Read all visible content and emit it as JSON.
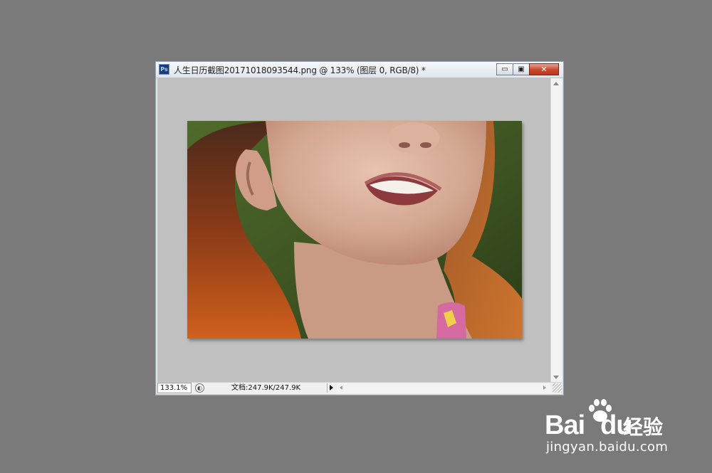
{
  "document_window": {
    "app_icon_text": "Ps",
    "title": "人生日历截图20171018093544.png @ 133% (图层 0, RGB/8) *",
    "minimize_glyph": "▭",
    "maximize_glyph": "▣",
    "close_glyph": "✕"
  },
  "canvas": {
    "background_color": "#c0c0c0",
    "image_subject": "smiling-woman-photo"
  },
  "status_bar": {
    "zoom": "133.1%",
    "doc_info": "文档:247.9K/247.9K"
  },
  "watermark": {
    "brand_a": "Bai",
    "brand_b": "du",
    "brand_cn": "经验",
    "url": "jingyan.baidu.com"
  }
}
